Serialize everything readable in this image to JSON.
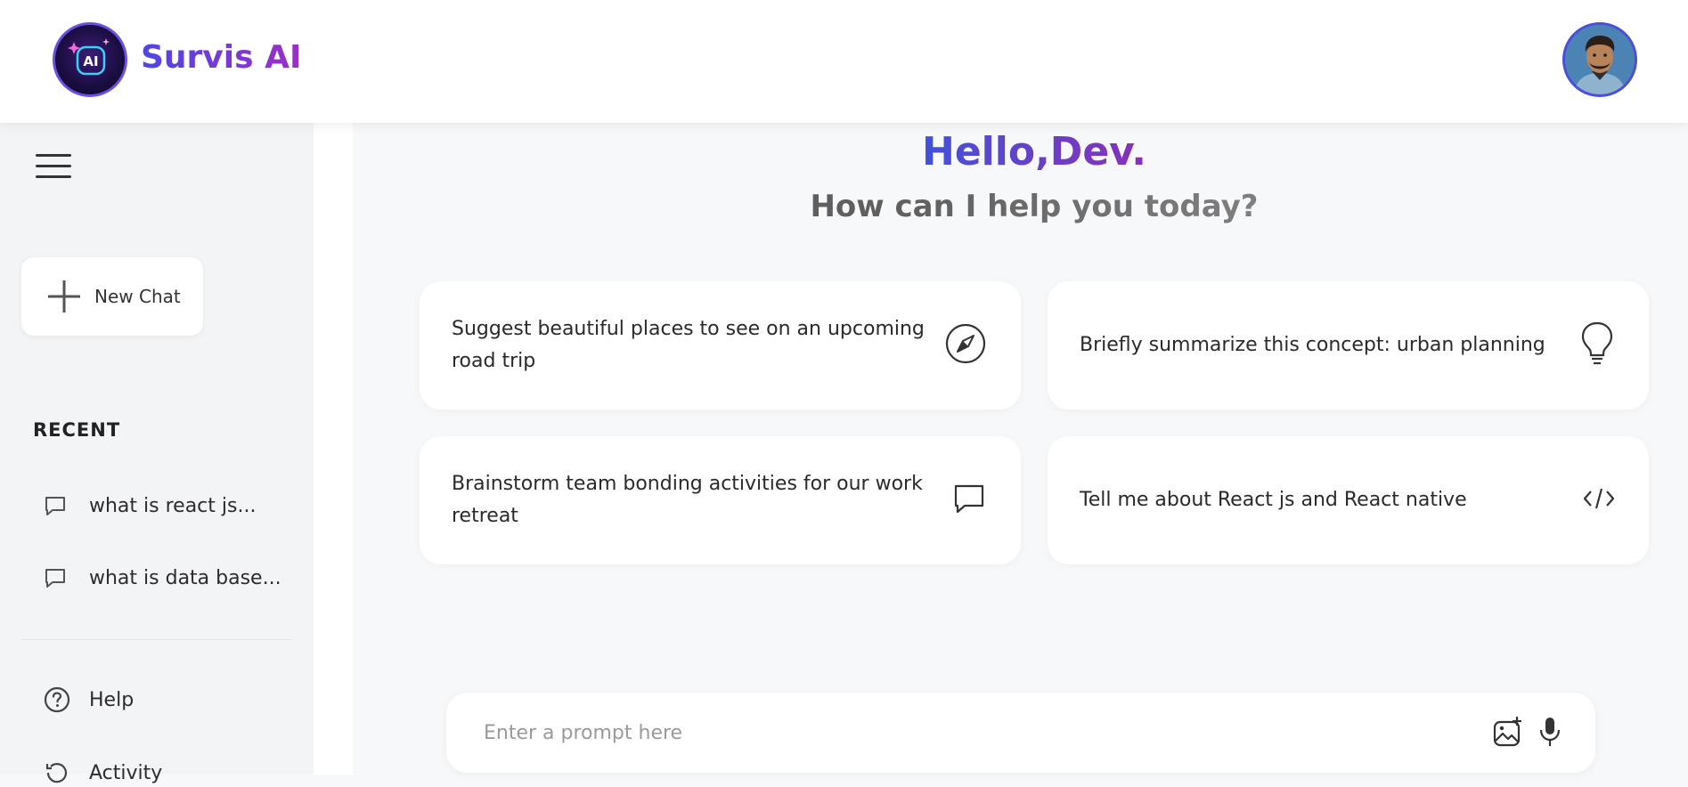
{
  "header": {
    "brand": "Survis AI",
    "logo_text": "AI"
  },
  "sidebar": {
    "new_chat_label": "New Chat",
    "recent_title": "RECENT",
    "recent_items": [
      {
        "label": "what is react js..."
      },
      {
        "label": "what is data base..."
      }
    ],
    "help_label": "Help",
    "activity_label": "Activity"
  },
  "main": {
    "greeting": "Hello,Dev.",
    "subtitle": "How can I help you today?",
    "cards": [
      {
        "text": "Suggest beautiful places to see on an upcoming road trip",
        "icon": "compass-icon"
      },
      {
        "text": "Briefly summarize this concept: urban planning",
        "icon": "bulb-icon"
      },
      {
        "text": "Brainstorm team bonding activities for our work retreat",
        "icon": "message-icon"
      },
      {
        "text": "Tell me about React js and React native",
        "icon": "code-icon"
      }
    ],
    "prompt_placeholder": "Enter a prompt here"
  },
  "colors": {
    "brand_start": "#4f46e5",
    "brand_end": "#9b2fc7",
    "background": "#f7f8fa"
  }
}
